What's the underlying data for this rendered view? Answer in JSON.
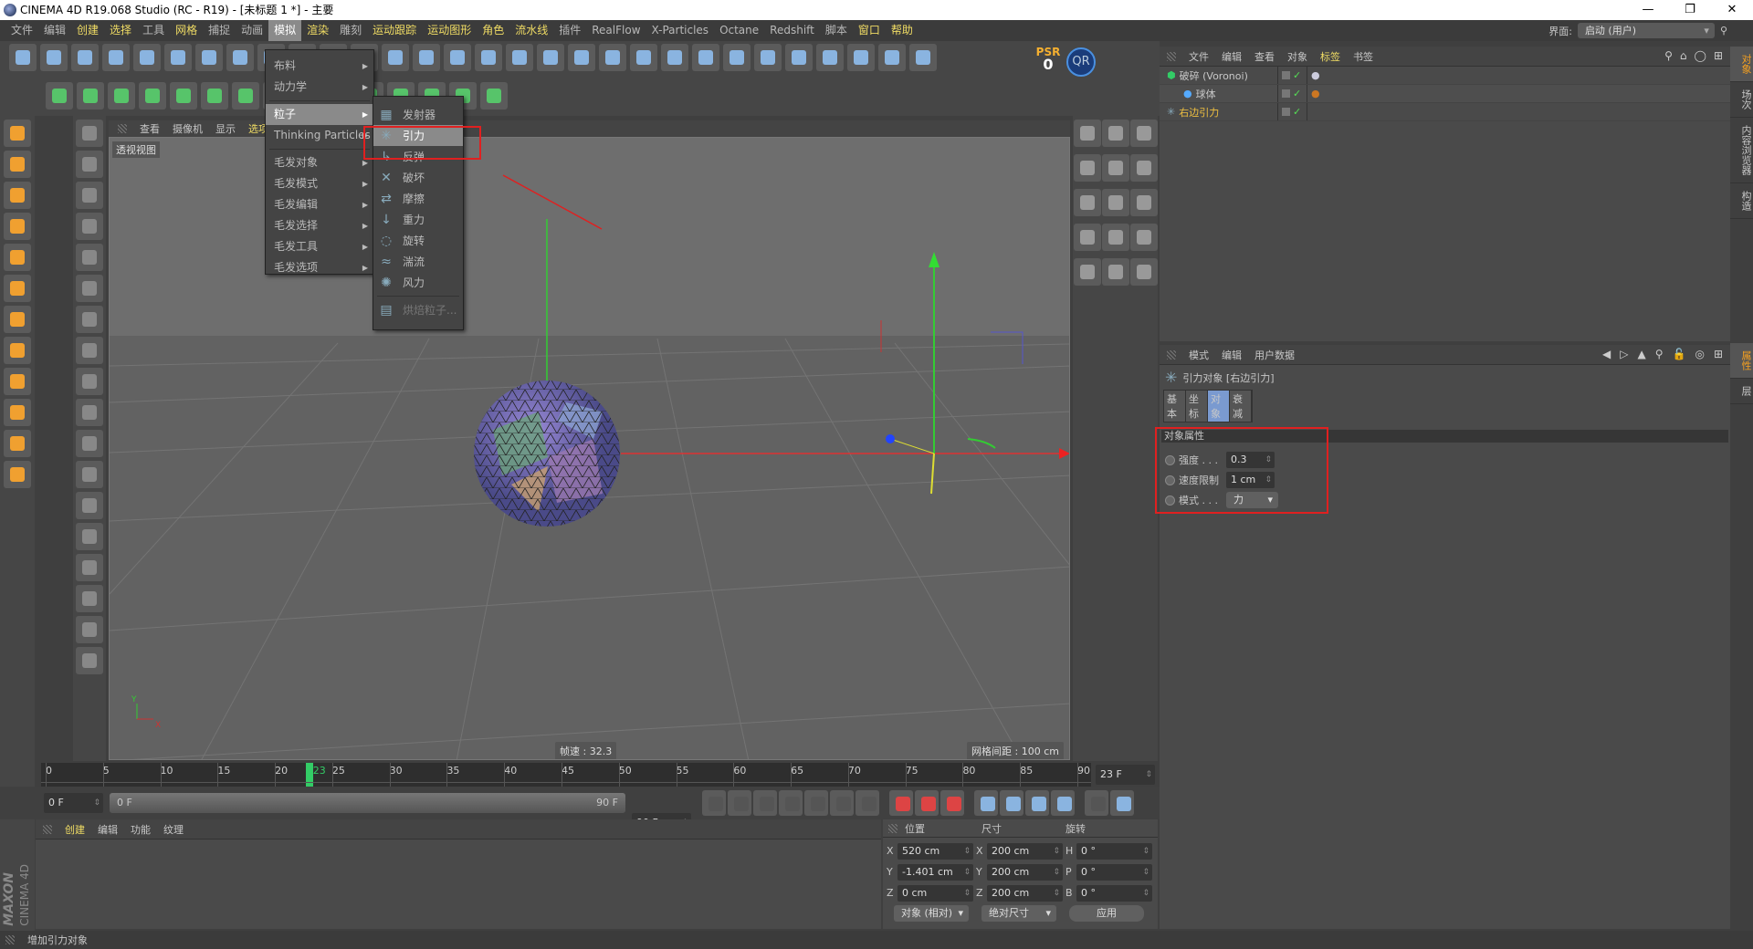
{
  "window": {
    "title": "CINEMA 4D R19.068 Studio (RC - R19) - [未标题 1 *] - 主要",
    "controls": [
      "—",
      "❐",
      "✕"
    ]
  },
  "menubar": {
    "items": [
      {
        "label": "文件",
        "hl": false
      },
      {
        "label": "编辑",
        "hl": false
      },
      {
        "label": "创建",
        "hl": true
      },
      {
        "label": "选择",
        "hl": true
      },
      {
        "label": "工具",
        "hl": false
      },
      {
        "label": "网格",
        "hl": true
      },
      {
        "label": "捕捉",
        "hl": false
      },
      {
        "label": "动画",
        "hl": false
      },
      {
        "label": "模拟",
        "hl": false,
        "open": true
      },
      {
        "label": "渲染",
        "hl": true
      },
      {
        "label": "雕刻",
        "hl": false
      },
      {
        "label": "运动跟踪",
        "hl": true
      },
      {
        "label": "运动图形",
        "hl": true
      },
      {
        "label": "角色",
        "hl": true
      },
      {
        "label": "流水线",
        "hl": true
      },
      {
        "label": "插件",
        "hl": false
      },
      {
        "label": "RealFlow",
        "hl": false
      },
      {
        "label": "X-Particles",
        "hl": false
      },
      {
        "label": "Octane",
        "hl": false
      },
      {
        "label": "Redshift",
        "hl": false
      },
      {
        "label": "脚本",
        "hl": false
      },
      {
        "label": "窗口",
        "hl": true
      },
      {
        "label": "帮助",
        "hl": true
      }
    ],
    "layout_label": "界面:",
    "layout_value": "启动 (用户)"
  },
  "toolbar": {
    "row1": [
      "undo-icon",
      "redo-icon",
      "select-icon",
      "move-icon",
      "scale-icon",
      "rotate-icon",
      "axis-icon",
      "x-axis-icon",
      "y-axis-icon",
      "z-axis-icon",
      "world-icon",
      "render-view-icon",
      "render-picture-icon",
      "render-settings-icon",
      "cube-icon",
      "pen-icon",
      "subdivision-icon",
      "cloner-icon",
      "deformer-icon",
      "floor-icon",
      "camera-icon",
      "light-icon",
      "tag-icon",
      "s-icon",
      "particle-icon",
      "xp-icon",
      "realflow-icon",
      "sphere-grid-icon",
      "voronoi-icon",
      "coord-icon"
    ],
    "psr_label": "PSR",
    "psr_value": "0",
    "qr_label": "QR",
    "row2": [
      "model-icon",
      "axis-mode-icon",
      "points-icon",
      "edges-icon",
      "polygons-icon",
      "uv-icon",
      "texture-icon",
      "emitter-icon",
      "mograph-icon",
      "cloth-icon",
      "text-icon",
      "green-cube-icon",
      "spline-icon",
      "sculpt-icon",
      "fx-icon"
    ],
    "colors": {
      "row1": "#8ab4e0",
      "row2": "#57c46a",
      "orange": "#f0a030"
    }
  },
  "left_tools": [
    "cube-tool-icon",
    "checker-icon",
    "layers-icon",
    "poly-icon",
    "cube-outline-icon",
    "orange-cube-icon",
    "l-icon",
    "mouse-icon",
    "s-circle-icon",
    "magnet-icon",
    "grid-lock-icon",
    "grid-snap-icon"
  ],
  "left_tools2": [
    "arrow-select-icon",
    "live-select-icon",
    "rect-select-icon",
    "lasso-icon",
    "poly-select-icon",
    "knife-icon",
    "bridge-icon",
    "extrude-icon",
    "bevel-icon",
    "sphere-icon",
    "dots-icon",
    "dots2-icon",
    "mirror-icon",
    "dots3-icon",
    "dots4-icon",
    "dots5-icon",
    "brush-icon",
    "brush2-icon"
  ],
  "right_tools": [
    "view-cube-icon",
    "perspective-icon",
    "pen-tool-icon",
    "brush-tool-icon",
    "knife-tool-icon",
    "polygon-pen-icon",
    "weld-icon",
    "edge-cut-icon",
    "slide-icon",
    "array-icon",
    "stitch-icon",
    "iron-icon",
    "magnet-tool-icon",
    "sculpt-tool-icon",
    "settings-icon"
  ],
  "viewport": {
    "menus": [
      "查看",
      "摄像机",
      "显示",
      "选项"
    ],
    "label": "透视视图",
    "fps": "帧速 : 32.3",
    "grid": "网格间距 : 100 cm",
    "axis_x": "X",
    "axis_y": "Y"
  },
  "sim_menu": {
    "items": [
      {
        "label": "布料",
        "sub": true
      },
      {
        "label": "动力学",
        "sub": true
      },
      {
        "sep": true
      },
      {
        "label": "粒子",
        "sub": true,
        "active": true
      },
      {
        "label": "Thinking Particles",
        "sub": true
      },
      {
        "sep": true
      },
      {
        "label": "毛发对象",
        "sub": true
      },
      {
        "label": "毛发模式",
        "sub": true
      },
      {
        "label": "毛发编辑",
        "sub": true
      },
      {
        "label": "毛发选择",
        "sub": true
      },
      {
        "label": "毛发工具",
        "sub": true
      },
      {
        "label": "毛发选项",
        "sub": true
      }
    ]
  },
  "particle_menu": {
    "items": [
      {
        "label": "发射器",
        "icon": "emitter-icon",
        "glyph": "▦"
      },
      {
        "label": "引力",
        "icon": "attractor-icon",
        "glyph": "✳",
        "active": true
      },
      {
        "label": "反弹",
        "icon": "deflector-icon",
        "glyph": "↳"
      },
      {
        "label": "破坏",
        "icon": "destructor-icon",
        "glyph": "✕"
      },
      {
        "label": "摩擦",
        "icon": "friction-icon",
        "glyph": "⇄"
      },
      {
        "label": "重力",
        "icon": "gravity-icon",
        "glyph": "↓"
      },
      {
        "label": "旋转",
        "icon": "rotation-icon",
        "glyph": "◌"
      },
      {
        "label": "湍流",
        "icon": "turbulence-icon",
        "glyph": "≈"
      },
      {
        "label": "风力",
        "icon": "wind-icon",
        "glyph": "✺"
      },
      {
        "label": "烘焙粒子...",
        "icon": "bake-icon",
        "glyph": "▤",
        "disabled": true
      }
    ]
  },
  "object_manager": {
    "menus": [
      {
        "label": "文件",
        "hl": false
      },
      {
        "label": "编辑",
        "hl": false
      },
      {
        "label": "查看",
        "hl": false
      },
      {
        "label": "对象",
        "hl": false
      },
      {
        "label": "标签",
        "hl": true
      },
      {
        "label": "书签",
        "hl": false
      }
    ],
    "objects": [
      {
        "name": "破碎 (Voronoi)",
        "icon": "voronoi-icon",
        "color": "#c8c8c8",
        "indent": 0
      },
      {
        "name": "球体",
        "icon": "sphere-icon",
        "color": "#c8c8c8",
        "indent": 1
      },
      {
        "name": "右边引力",
        "icon": "attractor-icon",
        "color": "#f0c040",
        "indent": 0
      }
    ]
  },
  "side_tabs": [
    {
      "label": "对象",
      "active": true
    },
    {
      "label": "场次"
    },
    {
      "label": "内容浏览器"
    },
    {
      "label": "构造"
    }
  ],
  "side_tabs2": [
    {
      "label": "属性",
      "active": true
    },
    {
      "label": "层"
    }
  ],
  "attributes": {
    "menus": [
      "模式",
      "编辑",
      "用户数据"
    ],
    "title": "引力对象 [右边引力]",
    "tabs": [
      {
        "label": "基本"
      },
      {
        "label": "坐标"
      },
      {
        "label": "对象",
        "active": true
      },
      {
        "label": "衰减"
      }
    ],
    "section": "对象属性",
    "fields": [
      {
        "label": "强度 . . .",
        "value": "0.3",
        "type": "number"
      },
      {
        "label": "速度限制",
        "value": "1 cm",
        "type": "number"
      },
      {
        "label": "模式 . . .",
        "value": "力",
        "type": "select"
      }
    ]
  },
  "timeline": {
    "ticks": [
      "0",
      "5",
      "10",
      "15",
      "20",
      "25",
      "30",
      "35",
      "40",
      "45",
      "50",
      "55",
      "60",
      "65",
      "70",
      "75",
      "80",
      "85",
      "90"
    ],
    "current": "23",
    "current_field": "23 F",
    "min": 0,
    "max": 90,
    "start_field": "0 F",
    "range_start": "0 F",
    "range_end": "90 F",
    "end_field": "90 F"
  },
  "playback": [
    "goto-start-icon",
    "prev-key-icon",
    "prev-frame-icon",
    "play-icon",
    "next-frame-icon",
    "next-key-icon",
    "goto-end-icon",
    "record-icon",
    "autokey-icon",
    "keyframe-help-icon",
    "move-key-icon",
    "scale-key-icon",
    "rotate-key-icon",
    "param-key-icon",
    "pla-key-icon",
    "timeline-icon"
  ],
  "materials": {
    "menus": [
      {
        "label": "创建",
        "hl": true
      },
      {
        "label": "编辑"
      },
      {
        "label": "功能"
      },
      {
        "label": "纹理"
      }
    ],
    "logo_top": "MAXON",
    "logo_bottom": "CINEMA 4D"
  },
  "coordinates": {
    "headers": [
      "位置",
      "尺寸",
      "旋转"
    ],
    "rows": [
      {
        "a": "X",
        "pos": "520 cm",
        "b": "X",
        "size": "200 cm",
        "c": "H",
        "rot": "0 °"
      },
      {
        "a": "Y",
        "pos": "-1.401 cm",
        "b": "Y",
        "size": "200 cm",
        "c": "P",
        "rot": "0 °"
      },
      {
        "a": "Z",
        "pos": "0 cm",
        "b": "Z",
        "size": "200 cm",
        "c": "B",
        "rot": "0 °"
      }
    ],
    "mode": "对象 (相对)",
    "size_mode": "绝对尺寸",
    "apply": "应用"
  },
  "status": "增加引力对象"
}
